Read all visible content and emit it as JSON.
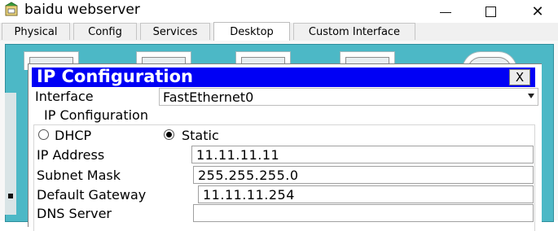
{
  "window": {
    "title": "baidu webserver",
    "min_glyph": "",
    "close_glyph": "✕"
  },
  "tabs": [
    {
      "label": "Physical",
      "active": false
    },
    {
      "label": "Config",
      "active": false
    },
    {
      "label": "Services",
      "active": false
    },
    {
      "label": "Desktop",
      "active": true
    },
    {
      "label": "Custom Interface",
      "active": false
    }
  ],
  "ip_window": {
    "title": "IP Configuration",
    "close_label": "X",
    "interface_label": "Interface",
    "interface_value": "FastEthernet0",
    "group_label": "IP Configuration",
    "dhcp_label": "DHCP",
    "static_label": "Static",
    "mode_selected": "Static",
    "fields": [
      {
        "label": "IP Address",
        "value": "11.11.11.11"
      },
      {
        "label": "Subnet Mask",
        "value": "255.255.255.0"
      },
      {
        "label": "Default Gateway",
        "value": "11.11.11.254"
      },
      {
        "label": "DNS Server",
        "value": ""
      }
    ]
  },
  "colors": {
    "title_blue": "#0000f5",
    "desktop_teal": "#4cb8c6"
  }
}
